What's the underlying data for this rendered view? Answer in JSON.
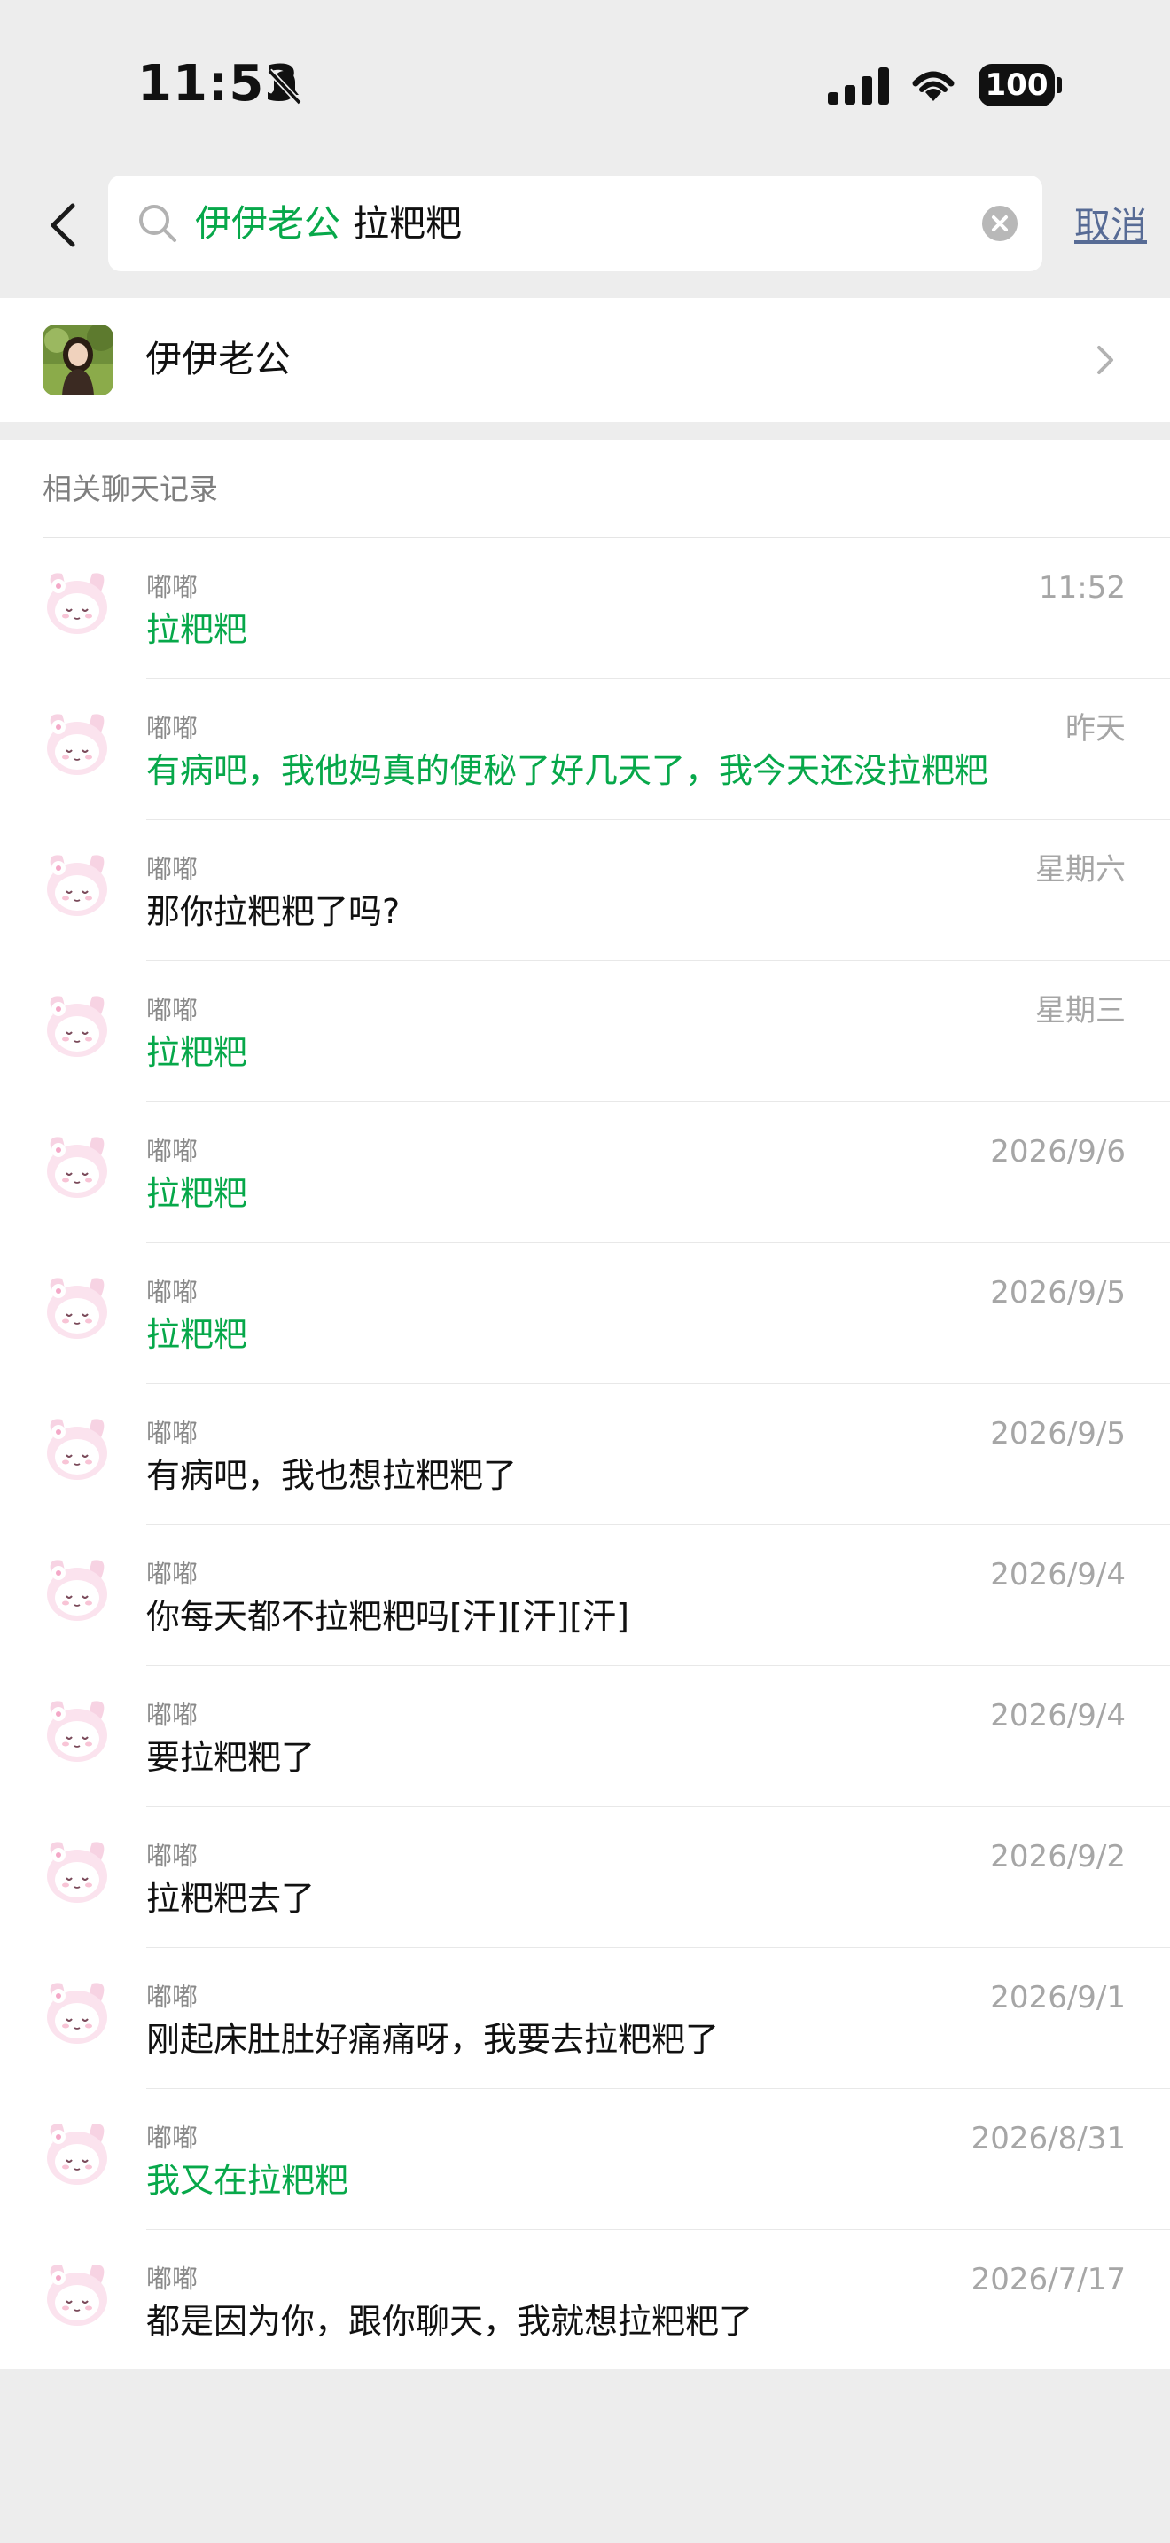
{
  "status_bar": {
    "time": "11:53",
    "battery": "100"
  },
  "search": {
    "contact_tag": "伊伊老公",
    "query": "拉粑粑",
    "cancel_label": "取消"
  },
  "contact": {
    "name": "伊伊老公"
  },
  "results": {
    "section_title": "相关聊天记录",
    "rows": [
      {
        "sender": "嘟嘟",
        "time": "11:52",
        "message": "拉粑粑",
        "highlighted": true
      },
      {
        "sender": "嘟嘟",
        "time": "昨天",
        "message": "有病吧，我他妈真的便秘了好几天了，我今天还没拉粑粑",
        "highlighted": true
      },
      {
        "sender": "嘟嘟",
        "time": "星期六",
        "message": "那你拉粑粑了吗?",
        "highlighted": false
      },
      {
        "sender": "嘟嘟",
        "time": "星期三",
        "message": "拉粑粑",
        "highlighted": true
      },
      {
        "sender": "嘟嘟",
        "time": "2026/9/6",
        "message": "拉粑粑",
        "highlighted": true
      },
      {
        "sender": "嘟嘟",
        "time": "2026/9/5",
        "message": "拉粑粑",
        "highlighted": true
      },
      {
        "sender": "嘟嘟",
        "time": "2026/9/5",
        "message": "有病吧，我也想拉粑粑了",
        "highlighted": false
      },
      {
        "sender": "嘟嘟",
        "time": "2026/9/4",
        "message": "你每天都不拉粑粑吗[汗][汗][汗]",
        "highlighted": false
      },
      {
        "sender": "嘟嘟",
        "time": "2026/9/4",
        "message": "要拉粑粑了",
        "highlighted": false
      },
      {
        "sender": "嘟嘟",
        "time": "2026/9/2",
        "message": "拉粑粑去了",
        "highlighted": false
      },
      {
        "sender": "嘟嘟",
        "time": "2026/9/1",
        "message": "刚起床肚肚好痛痛呀，我要去拉粑粑了",
        "highlighted": false
      },
      {
        "sender": "嘟嘟",
        "time": "2026/8/31",
        "message": "我又在拉粑粑",
        "highlighted": true
      },
      {
        "sender": "嘟嘟",
        "time": "2026/7/17",
        "message": "都是因为你，跟你聊天，我就想拉粑粑了",
        "highlighted": false
      }
    ]
  },
  "colors": {
    "highlight": "#07a84a",
    "link": "#576b95",
    "background": "#ededed"
  },
  "icons": [
    "bell-slash-icon",
    "signal-icon",
    "wifi-icon",
    "back-icon",
    "search-icon",
    "clear-icon",
    "chevron-right-icon",
    "avatar-icon"
  ]
}
